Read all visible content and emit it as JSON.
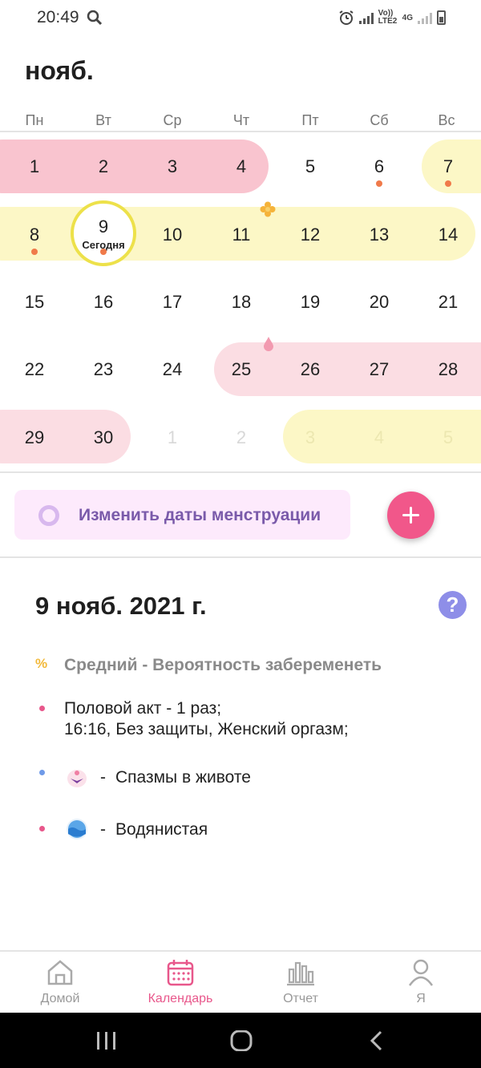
{
  "status": {
    "time": "20:49",
    "net1": "Vo)) LTE2",
    "net2": "4G"
  },
  "calendar": {
    "month": "нояб.",
    "weekdays": [
      "Пн",
      "Вт",
      "Ср",
      "Чт",
      "Пт",
      "Сб",
      "Вс"
    ],
    "weeks": [
      [
        "1",
        "2",
        "3",
        "4",
        "5",
        "6",
        "7"
      ],
      [
        "8",
        "9",
        "10",
        "11",
        "12",
        "13",
        "14"
      ],
      [
        "15",
        "16",
        "17",
        "18",
        "19",
        "20",
        "21"
      ],
      [
        "22",
        "23",
        "24",
        "25",
        "26",
        "27",
        "28"
      ],
      [
        "29",
        "30",
        "1",
        "2",
        "3",
        "4",
        "5"
      ]
    ],
    "today_number": "9",
    "today_label": "Сегодня"
  },
  "edit_button": {
    "label": "Изменить даты менструации"
  },
  "details": {
    "date": "9 нояб. 2021 г.",
    "help": "?",
    "pregnancy_symbol": "%",
    "pregnancy": "Средний - Вероятность забеременеть",
    "sex_line1": "Половой акт - 1 раз;",
    "sex_line2": "16:16, Без защиты, Женский оргазм;",
    "symptom_dash": "-",
    "symptom": "Спазмы в животе",
    "discharge_dash": "-",
    "discharge": "Водянистая"
  },
  "colors": {
    "accent": "#e8578b",
    "period": "#f9c4cf",
    "fertile": "#fcf7c6",
    "fab": "#f1578a"
  },
  "nav": {
    "home": "Домой",
    "calendar": "Календарь",
    "report": "Отчет",
    "me": "Я"
  }
}
